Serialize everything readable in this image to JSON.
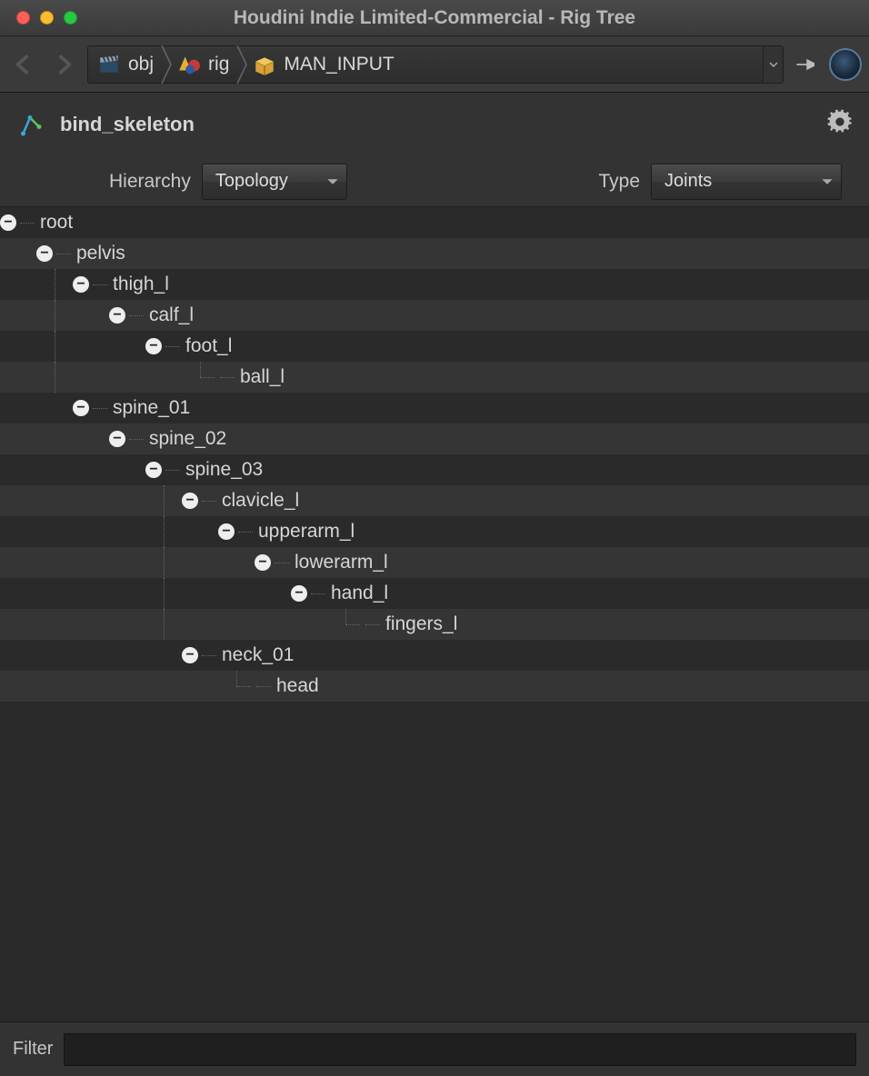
{
  "window": {
    "title": "Houdini Indie Limited-Commercial - Rig Tree"
  },
  "path": {
    "segments": [
      {
        "label": "obj",
        "icon": "clapper"
      },
      {
        "label": "rig",
        "icon": "cone-ball"
      },
      {
        "label": "MAN_INPUT",
        "icon": "box"
      }
    ]
  },
  "node": {
    "name": "bind_skeleton"
  },
  "options": {
    "hierarchy_label": "Hierarchy",
    "hierarchy_value": "Topology",
    "type_label": "Type",
    "type_value": "Joints"
  },
  "tree_flat": [
    {
      "depth": 0,
      "expanded": true,
      "last": false,
      "label": "root"
    },
    {
      "depth": 1,
      "expanded": true,
      "last": false,
      "label": "pelvis"
    },
    {
      "depth": 2,
      "expanded": true,
      "last": false,
      "label": "thigh_l"
    },
    {
      "depth": 3,
      "expanded": true,
      "last": true,
      "label": "calf_l"
    },
    {
      "depth": 4,
      "expanded": true,
      "last": true,
      "label": "foot_l"
    },
    {
      "depth": 5,
      "expanded": null,
      "last": true,
      "label": "ball_l"
    },
    {
      "depth": 2,
      "expanded": true,
      "last": true,
      "label": "spine_01"
    },
    {
      "depth": 3,
      "expanded": true,
      "last": true,
      "label": "spine_02"
    },
    {
      "depth": 4,
      "expanded": true,
      "last": true,
      "label": "spine_03"
    },
    {
      "depth": 5,
      "expanded": true,
      "last": false,
      "label": "clavicle_l"
    },
    {
      "depth": 6,
      "expanded": true,
      "last": true,
      "label": "upperarm_l"
    },
    {
      "depth": 7,
      "expanded": true,
      "last": true,
      "label": "lowerarm_l"
    },
    {
      "depth": 8,
      "expanded": true,
      "last": true,
      "label": "hand_l"
    },
    {
      "depth": 9,
      "expanded": null,
      "last": true,
      "label": "fingers_l"
    },
    {
      "depth": 5,
      "expanded": true,
      "last": true,
      "label": "neck_01"
    },
    {
      "depth": 6,
      "expanded": null,
      "last": true,
      "label": "head"
    }
  ],
  "filter": {
    "label": "Filter",
    "value": ""
  }
}
